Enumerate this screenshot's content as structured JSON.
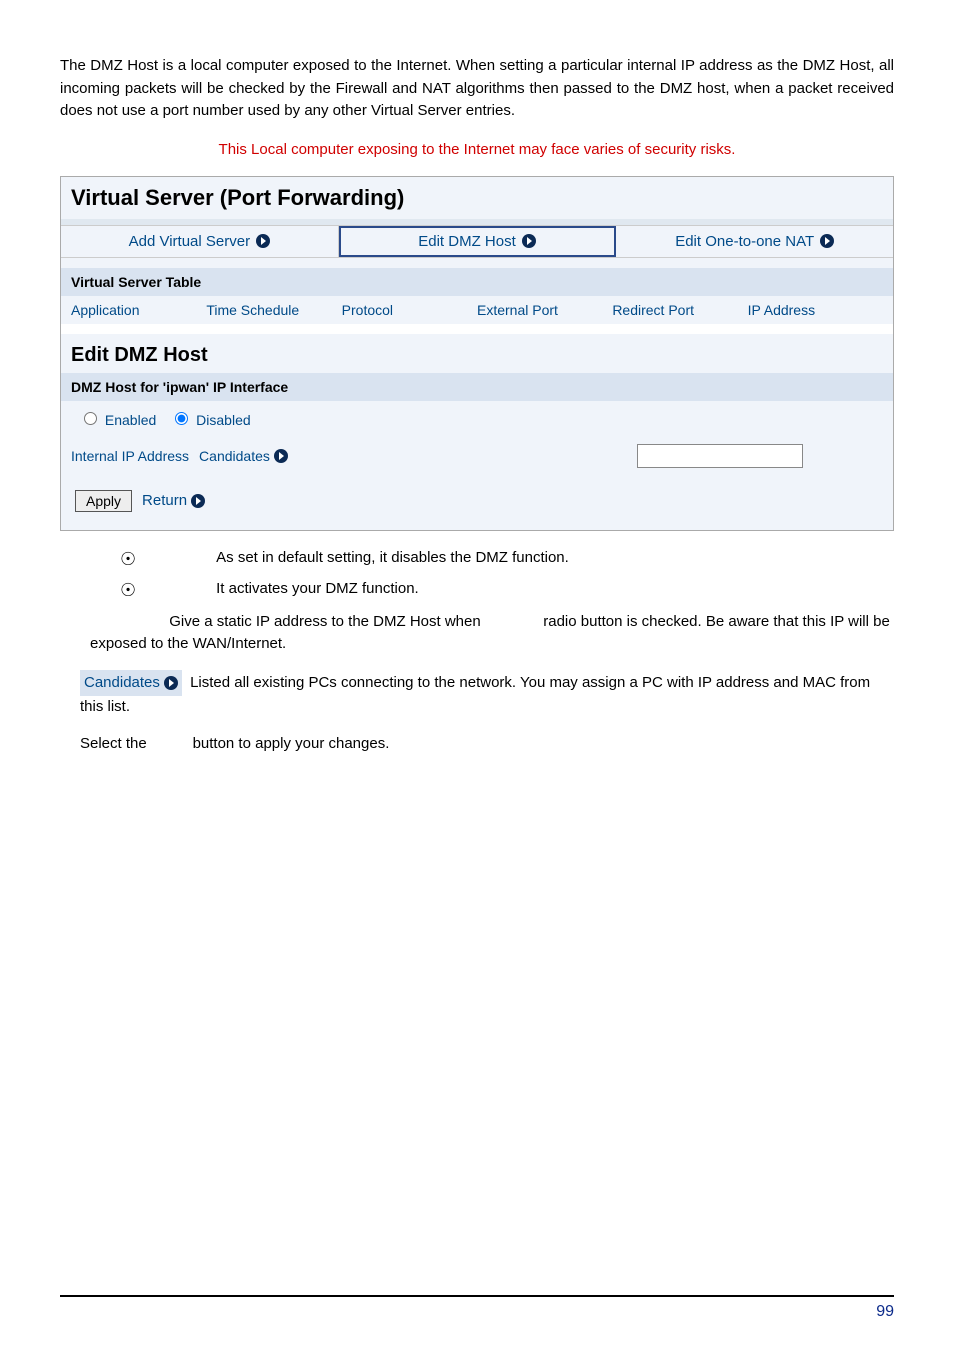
{
  "intro_para": "The DMZ Host is a local computer exposed to the Internet. When setting a particular internal IP address as the DMZ Host, all incoming packets will be checked by the Firewall and NAT algorithms then passed to the DMZ host, when a packet received does not use a port number used by any other Virtual Server entries.",
  "red_warning": "This Local computer exposing to the Internet may face varies of security risks.",
  "panel_title": "Virtual Server (Port Forwarding)",
  "tabs": {
    "add": "Add Virtual Server",
    "dmz": "Edit DMZ Host",
    "nat": "Edit One-to-one NAT"
  },
  "vs_table": {
    "heading": "Virtual Server Table",
    "cols": {
      "application": "Application",
      "time_schedule": "Time Schedule",
      "protocol": "Protocol",
      "external_port": "External Port",
      "redirect_port": "Redirect Port",
      "ip_address": "IP Address"
    }
  },
  "edit_dmz": {
    "title": "Edit DMZ Host",
    "interface_label": "DMZ Host for 'ipwan' IP Interface",
    "enabled_label": "Enabled",
    "disabled_label": "Disabled",
    "ip_label": "Internal IP Address",
    "candidates_label": "Candidates",
    "apply_label": "Apply",
    "return_label": "Return"
  },
  "notes": {
    "disabled_bullet": "As set in default setting, it disables the DMZ function.",
    "enabled_bullet": "It activates your DMZ function.",
    "ip_note_prefix": "Give a static IP address to the DMZ Host when",
    "ip_note_suffix": "radio button is checked.  Be aware that this IP will be exposed to the WAN/Internet.",
    "candidates_text": "Listed all existing PCs connecting to the network. You may assign a PC with IP address and MAC from this list.",
    "select_prefix": "Select the",
    "select_suffix": "button to apply your changes."
  },
  "footer_page": "99"
}
